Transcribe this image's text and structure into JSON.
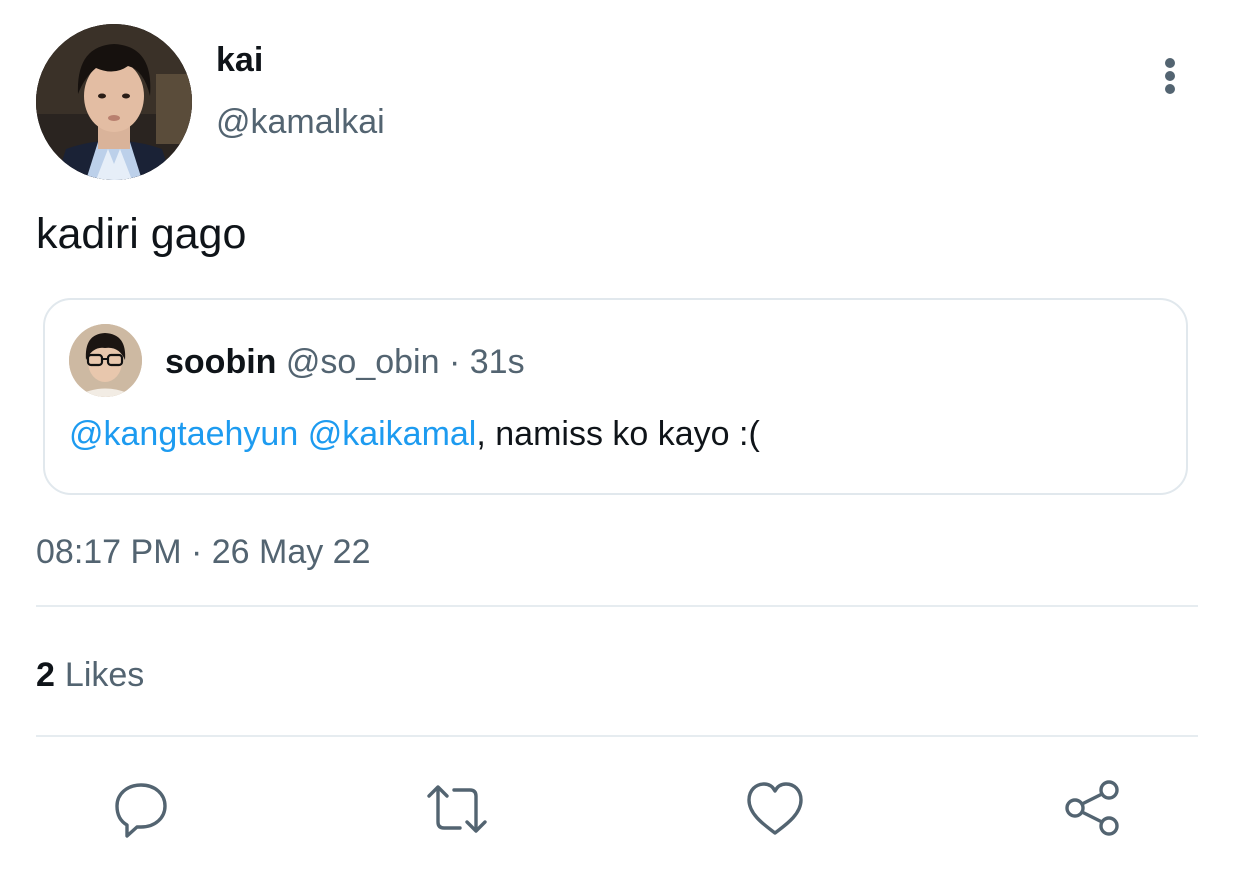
{
  "author": {
    "display_name": "kai",
    "handle": "@kamalkai"
  },
  "tweet": {
    "text": "kadiri gago",
    "timestamp": "08:17 PM · 26 May 22"
  },
  "quoted_tweet": {
    "display_name": "soobin",
    "handle": "@so_obin",
    "separator": "·",
    "time": "31s",
    "mentions": [
      "@kangtaehyun",
      "@kaikamal"
    ],
    "text_rest": ", namiss ko kayo :("
  },
  "stats": {
    "likes_count": "2",
    "likes_label": "Likes"
  },
  "actions": {
    "icons": [
      "reply-icon",
      "retweet-icon",
      "like-icon",
      "share-icon"
    ]
  },
  "colors": {
    "text_primary": "#0f1419",
    "text_secondary": "#536471",
    "link": "#1d9bf0",
    "border": "#e1e8ed"
  }
}
